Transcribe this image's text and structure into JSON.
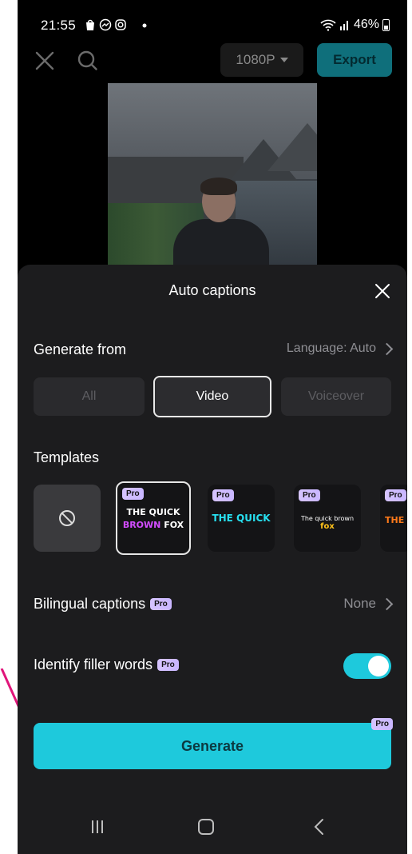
{
  "status_bar": {
    "time": "21:55",
    "battery": "46%"
  },
  "editor": {
    "resolution": "1080P",
    "export_label": "Export"
  },
  "sheet": {
    "title": "Auto captions",
    "generate_from_label": "Generate from",
    "language": "Language: Auto",
    "sources": [
      "All",
      "Video",
      "Voiceover"
    ],
    "selected_source": "Video",
    "templates_label": "Templates",
    "templates": [
      {
        "id": "none"
      },
      {
        "line1": "THE QUICK",
        "line2a": "BROWN",
        "line2b": "FOX",
        "pro": "Pro",
        "selected": true
      },
      {
        "text": "THE QUICK",
        "pro": "Pro"
      },
      {
        "text_a": "The quick brown",
        "text_b": "fox",
        "pro": "Pro"
      },
      {
        "text": "THE",
        "pro": "Pro"
      }
    ],
    "bilingual_label": "Bilingual captions",
    "bilingual_value": "None",
    "filler_label": "Identify filler words",
    "filler_enabled": true,
    "pro_badge": "Pro",
    "generate_label": "Generate"
  },
  "colors": {
    "accent": "#1ec9dc",
    "sheet": "#1c1c1e",
    "pro_badge": "#d6c4ff"
  }
}
